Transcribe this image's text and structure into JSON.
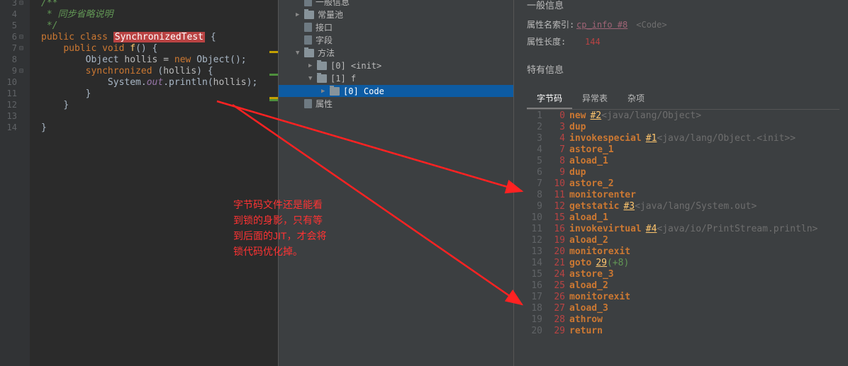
{
  "editor": {
    "lines": [
      {
        "n": 3,
        "indent": 0,
        "tokens": [
          {
            "t": "/**",
            "c": "comment"
          }
        ]
      },
      {
        "n": 4,
        "indent": 0,
        "tokens": [
          {
            "t": " * 同步省略说明",
            "c": "comment"
          }
        ]
      },
      {
        "n": 5,
        "indent": 0,
        "tokens": [
          {
            "t": " */",
            "c": "comment"
          }
        ]
      },
      {
        "n": 6,
        "indent": 0,
        "tokens": [
          {
            "t": "public ",
            "c": "kw"
          },
          {
            "t": "class ",
            "c": "kw"
          },
          {
            "t": "SynchronizedTest",
            "c": "hl"
          },
          {
            "t": " {",
            "c": "brace"
          }
        ]
      },
      {
        "n": 7,
        "indent": 1,
        "tokens": [
          {
            "t": "public ",
            "c": "kw"
          },
          {
            "t": "void ",
            "c": "kw"
          },
          {
            "t": "f",
            "c": "method"
          },
          {
            "t": "() {",
            "c": "brace"
          }
        ]
      },
      {
        "n": 8,
        "indent": 2,
        "tokens": [
          {
            "t": "Object ",
            "c": "cls"
          },
          {
            "t": "hollis = ",
            "c": "var"
          },
          {
            "t": "new ",
            "c": "kw"
          },
          {
            "t": "Object",
            "c": "cls"
          },
          {
            "t": "();",
            "c": "brace"
          }
        ]
      },
      {
        "n": 9,
        "indent": 2,
        "tokens": [
          {
            "t": "synchronized ",
            "c": "kw"
          },
          {
            "t": "(",
            "c": "brace"
          },
          {
            "t": "hollis",
            "c": "var"
          },
          {
            "t": ") {",
            "c": "brace"
          }
        ]
      },
      {
        "n": 10,
        "indent": 3,
        "tokens": [
          {
            "t": "System.",
            "c": "cls"
          },
          {
            "t": "out",
            "c": "str-it"
          },
          {
            "t": ".println(",
            "c": "cls"
          },
          {
            "t": "hollis",
            "c": "var"
          },
          {
            "t": ");",
            "c": "brace"
          }
        ]
      },
      {
        "n": 11,
        "indent": 2,
        "tokens": [
          {
            "t": "}",
            "c": "brace"
          }
        ]
      },
      {
        "n": 12,
        "indent": 1,
        "tokens": [
          {
            "t": "}",
            "c": "brace"
          }
        ]
      },
      {
        "n": 13,
        "indent": 0,
        "tokens": []
      },
      {
        "n": 14,
        "indent": 0,
        "tokens": [
          {
            "t": "}",
            "c": "brace"
          }
        ]
      }
    ]
  },
  "tree": [
    {
      "depth": 1,
      "arrow": "",
      "icon": "file",
      "label": "一般信息"
    },
    {
      "depth": 1,
      "arrow": "▶",
      "icon": "dir",
      "label": "常量池"
    },
    {
      "depth": 1,
      "arrow": "",
      "icon": "file",
      "label": "接口"
    },
    {
      "depth": 1,
      "arrow": "",
      "icon": "file",
      "label": "字段"
    },
    {
      "depth": 1,
      "arrow": "▼",
      "icon": "dir",
      "label": "方法"
    },
    {
      "depth": 2,
      "arrow": "▶",
      "icon": "dir",
      "label": "[0] <init>"
    },
    {
      "depth": 2,
      "arrow": "▼",
      "icon": "dir",
      "label": "[1] f"
    },
    {
      "depth": 3,
      "arrow": "▶",
      "icon": "dir",
      "label": "[0] Code",
      "selected": true
    },
    {
      "depth": 1,
      "arrow": "",
      "icon": "file",
      "label": "属性"
    }
  ],
  "right": {
    "header": "一般信息",
    "attr_index_label": "属性名索引:",
    "attr_index_link": "cp_info #8",
    "attr_index_comment": "<Code>",
    "attr_len_label": "属性长度:",
    "attr_len_val": "144",
    "section2": "特有信息",
    "tabs": [
      "字节码",
      "异常表",
      "杂项"
    ],
    "active_tab": 0
  },
  "bytecode": [
    {
      "ln": 1,
      "off": 0,
      "op": "new",
      "link": "#2",
      "cm": "<java/lang/Object>"
    },
    {
      "ln": 2,
      "off": 3,
      "op": "dup"
    },
    {
      "ln": 3,
      "off": 4,
      "op": "invokespecial",
      "link": "#1",
      "cm": "<java/lang/Object.<init>>"
    },
    {
      "ln": 4,
      "off": 7,
      "op": "astore_1"
    },
    {
      "ln": 5,
      "off": 8,
      "op": "aload_1"
    },
    {
      "ln": 6,
      "off": 9,
      "op": "dup"
    },
    {
      "ln": 7,
      "off": 10,
      "op": "astore_2"
    },
    {
      "ln": 8,
      "off": 11,
      "op": "monitorenter"
    },
    {
      "ln": 9,
      "off": 12,
      "op": "getstatic",
      "link": "#3",
      "cm": "<java/lang/System.out>"
    },
    {
      "ln": 10,
      "off": 15,
      "op": "aload_1"
    },
    {
      "ln": 11,
      "off": 16,
      "op": "invokevirtual",
      "link": "#4",
      "cm": "<java/io/PrintStream.println>"
    },
    {
      "ln": 12,
      "off": 19,
      "op": "aload_2"
    },
    {
      "ln": 13,
      "off": 20,
      "op": "monitorexit"
    },
    {
      "ln": 14,
      "off": 21,
      "op": "goto",
      "link": "29",
      "plus": "(+8)"
    },
    {
      "ln": 15,
      "off": 24,
      "op": "astore_3"
    },
    {
      "ln": 16,
      "off": 25,
      "op": "aload_2"
    },
    {
      "ln": 17,
      "off": 26,
      "op": "monitorexit"
    },
    {
      "ln": 18,
      "off": 27,
      "op": "aload_3"
    },
    {
      "ln": 19,
      "off": 28,
      "op": "athrow"
    },
    {
      "ln": 20,
      "off": 29,
      "op": "return"
    }
  ],
  "annotation": {
    "l1": "字节码文件还是能看",
    "l2": "到锁的身影，只有等",
    "l3": "到后面的JIT，才会将",
    "l4": "锁代码优化掉。"
  }
}
